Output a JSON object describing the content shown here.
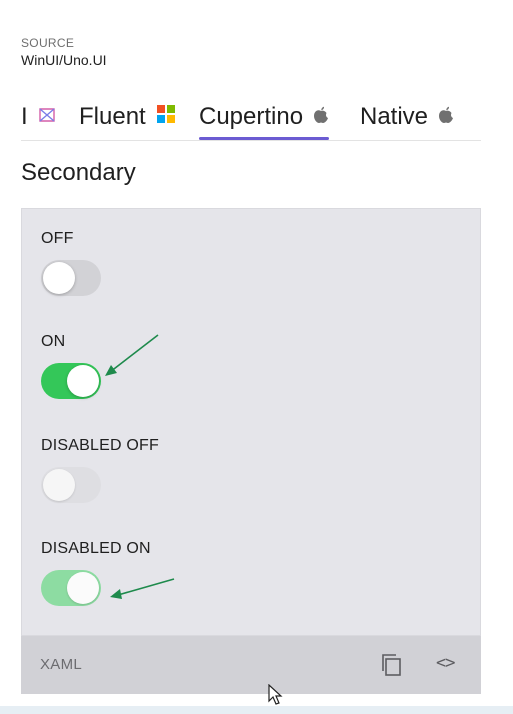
{
  "source": {
    "caption": "SOURCE",
    "value": "WinUI/Uno.UI"
  },
  "tabs": [
    {
      "label": "I",
      "icon": "material-logo-icon",
      "active": false
    },
    {
      "label": "Fluent",
      "icon": "windows-logo-icon",
      "active": false
    },
    {
      "label": "Cupertino",
      "icon": "apple-logo-icon",
      "active": true
    },
    {
      "label": "Native",
      "icon": "apple-logo-icon",
      "active": false
    }
  ],
  "section": {
    "title": "Secondary"
  },
  "toggles": [
    {
      "label": "OFF",
      "state": "off",
      "enabled": true
    },
    {
      "label": "ON",
      "state": "on",
      "enabled": true
    },
    {
      "label": "DISABLED OFF",
      "state": "off",
      "enabled": false
    },
    {
      "label": "DISABLED ON",
      "state": "on",
      "enabled": false
    }
  ],
  "footer": {
    "label": "XAML",
    "copy_icon": "copy-icon",
    "code_icon": "code-icon",
    "code_glyph": "<>"
  },
  "colors": {
    "accent_underline": "#6b5bd2",
    "toggle_on": "#34c759",
    "toggle_disabled_on": "#8ddca2",
    "panel_background": "#e5e5ea",
    "annotation_arrow": "#1e8a4c"
  }
}
